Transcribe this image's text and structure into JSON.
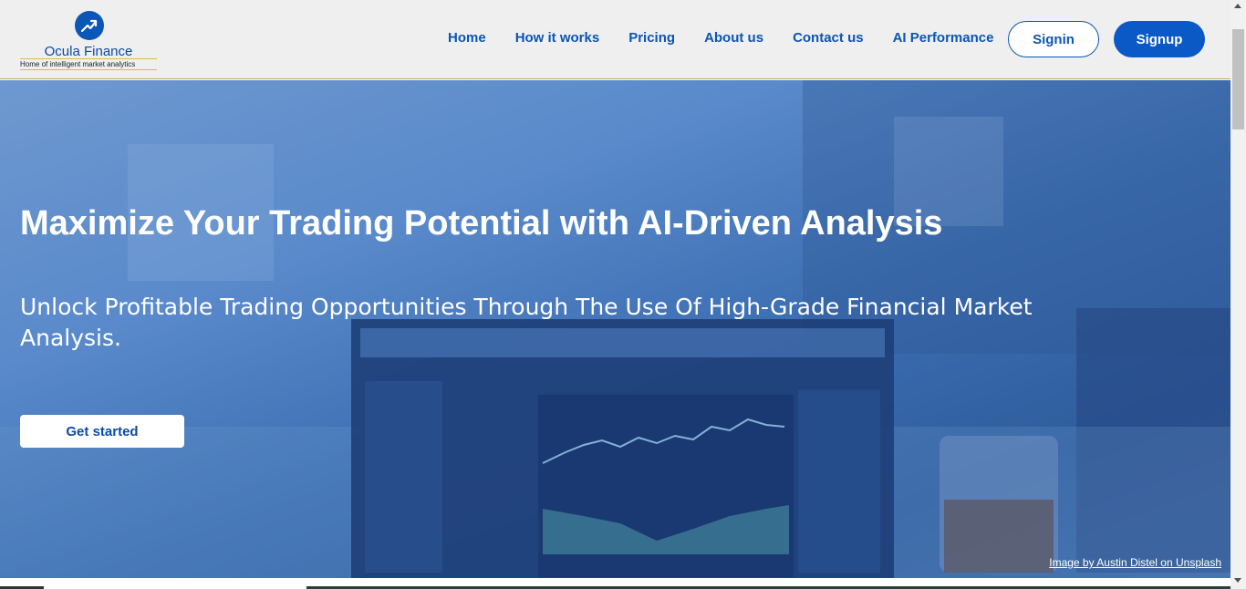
{
  "brand": {
    "name": "Ocula Finance",
    "tagline": "Home of intelligent market analytics",
    "logo_icon": "trend-up-icon",
    "color": "#0b56b3"
  },
  "nav": {
    "items": [
      {
        "label": "Home"
      },
      {
        "label": "How it works"
      },
      {
        "label": "Pricing"
      },
      {
        "label": "About us"
      },
      {
        "label": "Contact us"
      },
      {
        "label": "AI Performance"
      }
    ],
    "signin_label": "Signin",
    "signup_label": "Signup"
  },
  "hero": {
    "title": "Maximize Your Trading Potential with AI-Driven Analysis",
    "subtitle": "Unlock Profitable Trading Opportunities Through The Use Of High-Grade Financial Market Analysis.",
    "cta_label": "Get started",
    "credit": "Image by Austin Distel on Unsplash"
  },
  "colors": {
    "accent": "#0a59c6",
    "header_bg": "#efefef",
    "hero_overlay": "#4a7fc4"
  }
}
